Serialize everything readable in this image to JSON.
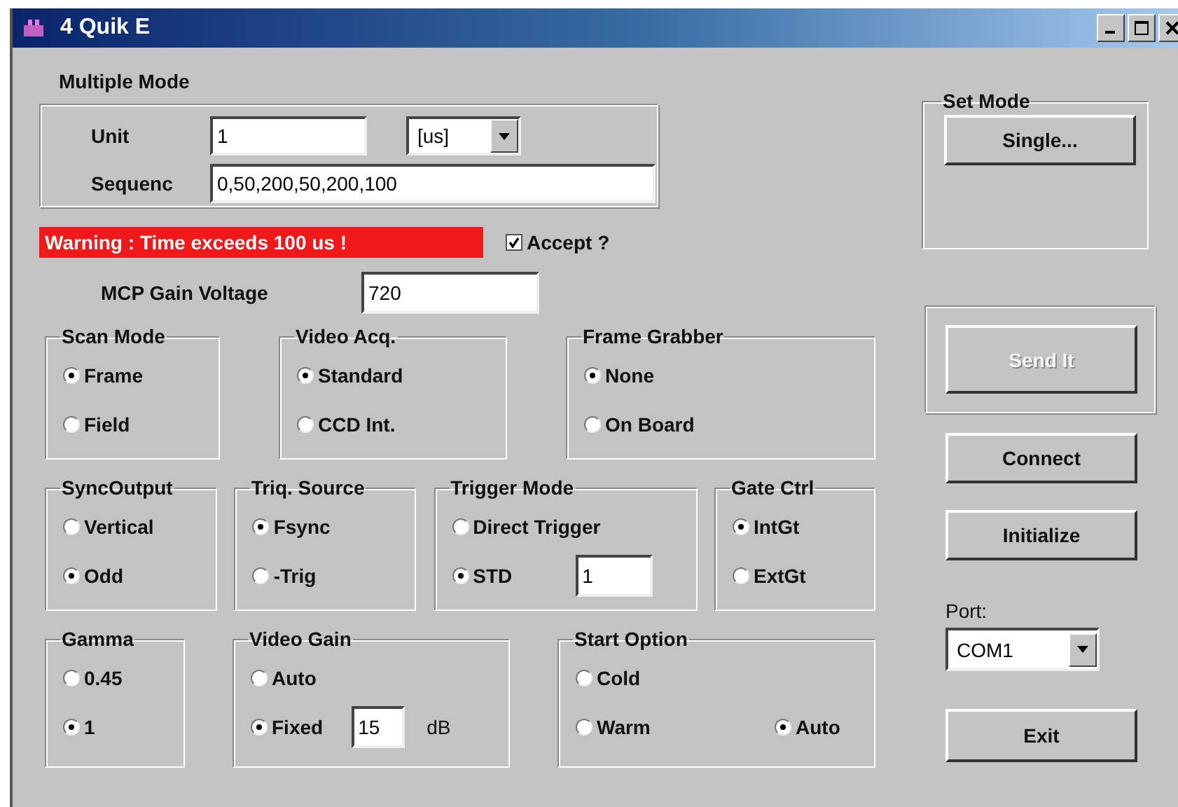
{
  "window": {
    "title": "4 Quik E"
  },
  "multiple_mode": {
    "title": "Multiple Mode",
    "unit": {
      "label": "Unit",
      "value": "1",
      "select": "[us]"
    },
    "sequence": {
      "label": "Sequenc",
      "value": "0,50,200,50,200,100"
    }
  },
  "warning": "Warning : Time exceeds 100 us !",
  "accept": {
    "label": "Accept ?",
    "checked": true
  },
  "mcp_gain": {
    "label": "MCP Gain Voltage",
    "value": "720"
  },
  "group_rows": [
    [
      {
        "title": "Scan Mode",
        "rows": [
          [
            {
              "label": "Frame",
              "selected": true
            }
          ],
          [
            {
              "label": "Field",
              "selected": false
            }
          ]
        ]
      },
      {
        "title": "Video Acq.",
        "rows": [
          [
            {
              "label": "Standard",
              "selected": true
            }
          ],
          [
            {
              "label": "CCD Int.",
              "selected": false
            }
          ]
        ]
      },
      {
        "title": "Frame Grabber",
        "rows": [
          [
            {
              "label": "None",
              "selected": true
            }
          ],
          [
            {
              "label": "On Board",
              "selected": false
            }
          ]
        ]
      }
    ],
    [
      {
        "title": "SyncOutput",
        "rows": [
          [
            {
              "label": "Vertical",
              "selected": false
            }
          ],
          [
            {
              "label": "Odd",
              "selected": true
            }
          ]
        ]
      },
      {
        "title": "Triq. Source",
        "rows": [
          [
            {
              "label": "Fsync",
              "selected": true
            }
          ],
          [
            {
              "label": "-Trig",
              "selected": false
            }
          ]
        ]
      },
      {
        "title": "Trigger Mode",
        "rows": [
          [
            {
              "label": "Direct Trigger",
              "selected": false
            }
          ],
          [
            {
              "label": "STD",
              "selected": true,
              "field": "1"
            }
          ]
        ]
      },
      {
        "title": "Gate Ctrl",
        "rows": [
          [
            {
              "label": "IntGt",
              "selected": true
            }
          ],
          [
            {
              "label": "ExtGt",
              "selected": false
            }
          ]
        ]
      }
    ],
    [
      {
        "title": "Gamma",
        "rows": [
          [
            {
              "label": "0.45",
              "selected": false
            }
          ],
          [
            {
              "label": "1",
              "selected": true
            }
          ]
        ]
      },
      {
        "title": "Video Gain",
        "rows": [
          [
            {
              "label": "Auto",
              "selected": false
            }
          ],
          [
            {
              "label": "Fixed",
              "selected": true,
              "field": "15",
              "unit": "dB"
            }
          ]
        ]
      },
      {
        "title": "Start Option",
        "rows": [
          [
            {
              "label": "Cold",
              "selected": false
            }
          ],
          [
            {
              "label": "Warm",
              "selected": false
            },
            {
              "label": "Auto",
              "selected": true
            }
          ]
        ]
      }
    ]
  ],
  "set_mode": {
    "title": "Set Mode",
    "button": "Single..."
  },
  "send_button": {
    "label": "Send It",
    "disabled": true
  },
  "side_buttons": [
    {
      "label": "Connect"
    },
    {
      "label": "Initialize"
    }
  ],
  "port": {
    "label": "Port:",
    "value": "COM1"
  },
  "exit_button": "Exit"
}
